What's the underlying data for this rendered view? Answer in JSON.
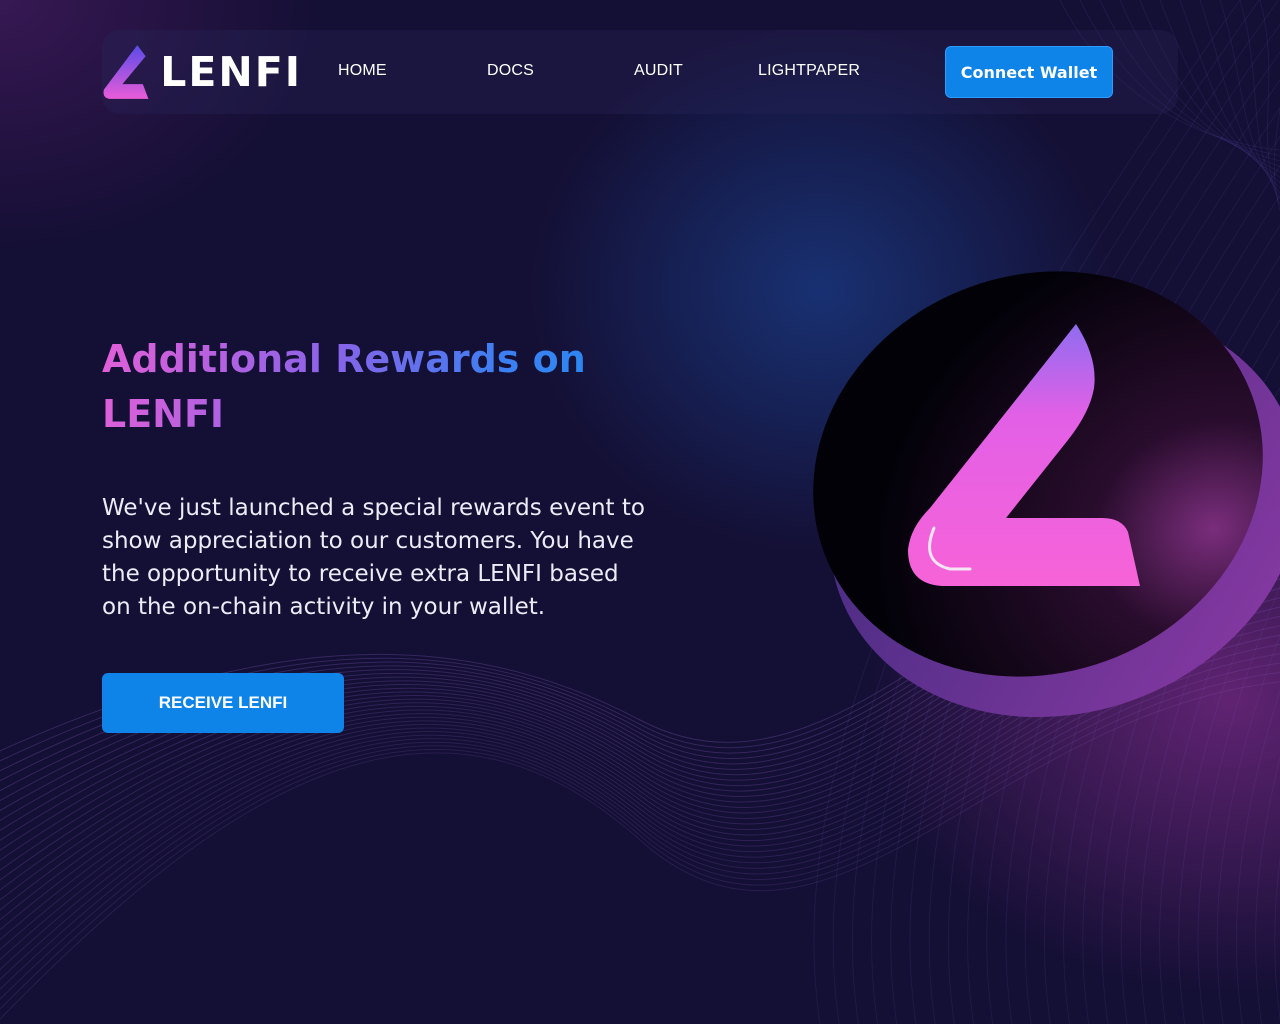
{
  "brand": {
    "name": "LENFI",
    "accent_blue": "#0e83e8",
    "gradient_pink": "#e35fd8",
    "gradient_violet": "#8a63e8",
    "background": "#140f34"
  },
  "nav": {
    "links": [
      "HOME",
      "DOCS",
      "AUDIT",
      "LIGHTPAPER"
    ],
    "connect_label": "Connect Wallet"
  },
  "hero": {
    "title": "Additional Rewards on LENFI",
    "description": "We've just launched a special rewards event to show appreciation to our customers. You have the opportunity to receive extra LENFI based on the on-chain activity in your wallet.",
    "cta_label": "RECEIVE LENFI"
  },
  "icons": {
    "logo": "lenfi-logo-icon",
    "coin": "lenfi-coin-icon"
  }
}
